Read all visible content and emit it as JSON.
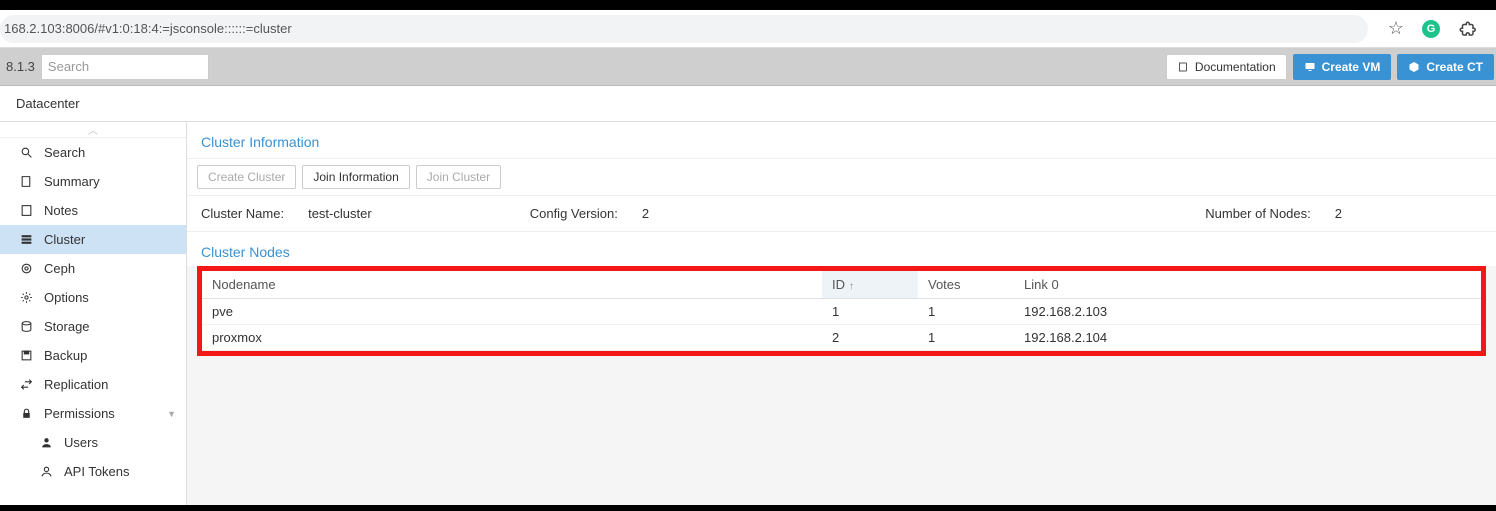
{
  "browser": {
    "url": "168.2.103:8006/#v1:0:18:4:=jsconsole::::::=cluster"
  },
  "header": {
    "version": "8.1.3",
    "search_placeholder": "Search",
    "doc_label": "Documentation",
    "create_vm_label": "Create VM",
    "create_ct_label": "Create CT"
  },
  "breadcrumb": "Datacenter",
  "sidebar": {
    "items": [
      {
        "icon": "search",
        "label": "Search"
      },
      {
        "icon": "summary",
        "label": "Summary"
      },
      {
        "icon": "notes",
        "label": "Notes"
      },
      {
        "icon": "cluster",
        "label": "Cluster",
        "selected": true
      },
      {
        "icon": "ceph",
        "label": "Ceph"
      },
      {
        "icon": "options",
        "label": "Options"
      },
      {
        "icon": "storage",
        "label": "Storage"
      },
      {
        "icon": "backup",
        "label": "Backup"
      },
      {
        "icon": "replication",
        "label": "Replication"
      },
      {
        "icon": "permissions",
        "label": "Permissions",
        "expandable": true
      },
      {
        "icon": "user",
        "label": "Users",
        "sub": true
      },
      {
        "icon": "token",
        "label": "API Tokens",
        "sub": true
      }
    ]
  },
  "cluster_info": {
    "section_title": "Cluster Information",
    "buttons": {
      "create": "Create Cluster",
      "join_info": "Join Information",
      "join": "Join Cluster"
    },
    "name_label": "Cluster Name:",
    "name_value": "test-cluster",
    "config_label": "Config Version:",
    "config_value": "2",
    "nodes_label": "Number of Nodes:",
    "nodes_value": "2"
  },
  "cluster_nodes": {
    "section_title": "Cluster Nodes",
    "columns": {
      "nodename": "Nodename",
      "id": "ID",
      "votes": "Votes",
      "link0": "Link 0"
    },
    "sort": {
      "column": "id",
      "dir": "asc"
    },
    "rows": [
      {
        "nodename": "pve",
        "id": "1",
        "votes": "1",
        "link0": "192.168.2.103"
      },
      {
        "nodename": "proxmox",
        "id": "2",
        "votes": "1",
        "link0": "192.168.2.104"
      }
    ]
  }
}
